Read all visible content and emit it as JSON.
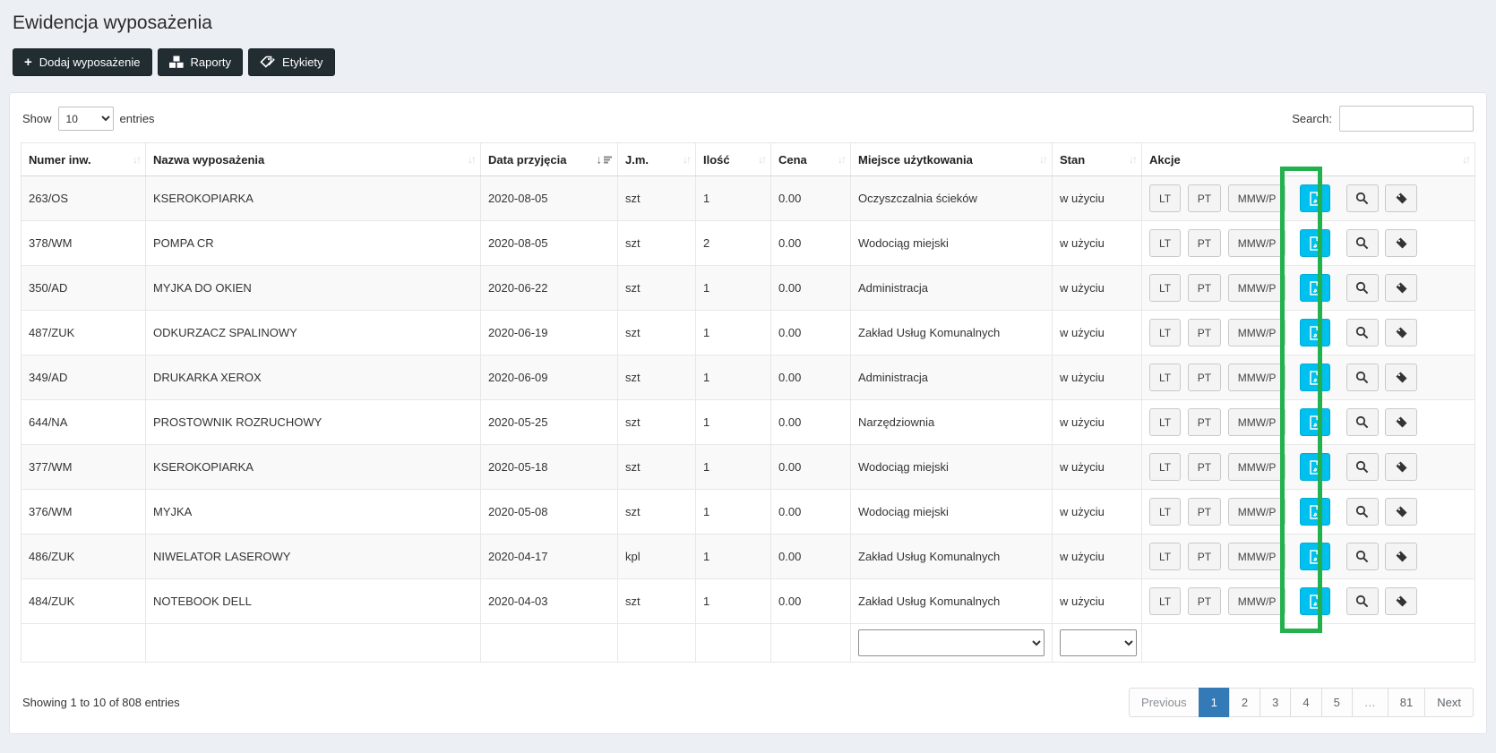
{
  "page": {
    "title": "Ewidencja wyposażenia"
  },
  "toolbar": {
    "add_label": "Dodaj wyposażenie",
    "reports_label": "Raporty",
    "labels_label": "Etykiety"
  },
  "table_controls": {
    "show_label": "Show",
    "entries_label": "entries",
    "page_length": "10",
    "search_label": "Search:",
    "search_value": ""
  },
  "table": {
    "columns": [
      "Numer inw.",
      "Nazwa wyposażenia",
      "Data przyjęcia",
      "J.m.",
      "Ilość",
      "Cena",
      "Miejsce użytkowania",
      "Stan",
      "Akcje"
    ],
    "sorted_column": "Data przyjęcia",
    "sort_direction": "descending",
    "action_buttons": [
      "LT",
      "PT",
      "MMW/P"
    ],
    "action_icons": [
      "pdf-file-icon",
      "search-icon",
      "tag-icon"
    ],
    "rows": [
      {
        "numer": "263/OS",
        "nazwa": "KSEROKOPIARKA",
        "data": "2020-08-05",
        "jm": "szt",
        "ilosc": "1",
        "cena": "0.00",
        "miejsce": "Oczyszczalnia ścieków",
        "stan": "w użyciu"
      },
      {
        "numer": "378/WM",
        "nazwa": "POMPA CR",
        "data": "2020-08-05",
        "jm": "szt",
        "ilosc": "2",
        "cena": "0.00",
        "miejsce": "Wodociąg miejski",
        "stan": "w użyciu"
      },
      {
        "numer": "350/AD",
        "nazwa": "MYJKA DO OKIEN",
        "data": "2020-06-22",
        "jm": "szt",
        "ilosc": "1",
        "cena": "0.00",
        "miejsce": "Administracja",
        "stan": "w użyciu"
      },
      {
        "numer": "487/ZUK",
        "nazwa": "ODKURZACZ SPALINOWY",
        "data": "2020-06-19",
        "jm": "szt",
        "ilosc": "1",
        "cena": "0.00",
        "miejsce": "Zakład Usług Komunalnych",
        "stan": "w użyciu"
      },
      {
        "numer": "349/AD",
        "nazwa": "DRUKARKA XEROX",
        "data": "2020-06-09",
        "jm": "szt",
        "ilosc": "1",
        "cena": "0.00",
        "miejsce": "Administracja",
        "stan": "w użyciu"
      },
      {
        "numer": "644/NA",
        "nazwa": "PROSTOWNIK ROZRUCHOWY",
        "data": "2020-05-25",
        "jm": "szt",
        "ilosc": "1",
        "cena": "0.00",
        "miejsce": "Narzędziownia",
        "stan": "w użyciu"
      },
      {
        "numer": "377/WM",
        "nazwa": "KSEROKOPIARKA",
        "data": "2020-05-18",
        "jm": "szt",
        "ilosc": "1",
        "cena": "0.00",
        "miejsce": "Wodociąg miejski",
        "stan": "w użyciu"
      },
      {
        "numer": "376/WM",
        "nazwa": "MYJKA",
        "data": "2020-05-08",
        "jm": "szt",
        "ilosc": "1",
        "cena": "0.00",
        "miejsce": "Wodociąg miejski",
        "stan": "w użyciu"
      },
      {
        "numer": "486/ZUK",
        "nazwa": "NIWELATOR LASEROWY",
        "data": "2020-04-17",
        "jm": "kpl",
        "ilosc": "1",
        "cena": "0.00",
        "miejsce": "Zakład Usług Komunalnych",
        "stan": "w użyciu"
      },
      {
        "numer": "484/ZUK",
        "nazwa": "NOTEBOOK DELL",
        "data": "2020-04-03",
        "jm": "szt",
        "ilosc": "1",
        "cena": "0.00",
        "miejsce": "Zakład Usług Komunalnych",
        "stan": "w użyciu"
      }
    ]
  },
  "footer": {
    "showing_text": "Showing 1 to 10 of 808 entries",
    "pagination": [
      "Previous",
      "1",
      "2",
      "3",
      "4",
      "5",
      "…",
      "81",
      "Next"
    ],
    "active_page": "1"
  },
  "colors": {
    "page_background": "#ecf0f5",
    "dark_button": "#222d32",
    "pdf_button_cyan": "#00c0ef",
    "annotation_green": "#22b14c",
    "active_page_blue": "#337ab7"
  }
}
